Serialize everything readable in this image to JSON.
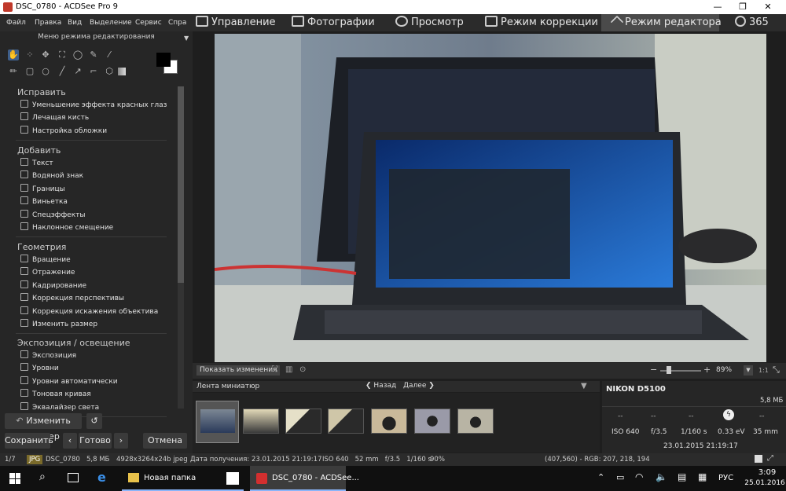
{
  "window": {
    "title": "DSC_0780 - ACDSee Pro 9",
    "min": "—",
    "max": "❐",
    "close": "✕"
  },
  "menu": [
    "Файл",
    "Правка",
    "Вид",
    "Выделение",
    "Сервис",
    "Спра"
  ],
  "modes": [
    {
      "label": "Управление",
      "icon": "grid-icon"
    },
    {
      "label": "Фотографии",
      "icon": "photos-icon"
    },
    {
      "label": "Просмотр",
      "icon": "eye-icon"
    },
    {
      "label": "Режим коррекции",
      "icon": "develop-icon"
    },
    {
      "label": "Режим редактора",
      "icon": "edit-tools-icon"
    },
    {
      "label": "365",
      "icon": "365-icon"
    }
  ],
  "panel": {
    "title": "Меню режима редактирования",
    "sections": [
      {
        "title": "Исправить",
        "items": [
          "Уменьшение эффекта красных глаз",
          "Лечащая кисть",
          "Настройка обложки"
        ]
      },
      {
        "title": "Добавить",
        "items": [
          "Текст",
          "Водяной знак",
          "Границы",
          "Виньетка",
          "Спецэффекты",
          "Наклонное смещение"
        ]
      },
      {
        "title": "Геометрия",
        "items": [
          "Вращение",
          "Отражение",
          "Кадрирование",
          "Коррекция перспективы",
          "Коррекция искажения объектива",
          "Изменить размер"
        ]
      },
      {
        "title": "Экспозиция / освещение",
        "items": [
          "Экспозиция",
          "Уровни",
          "Уровни автоматически",
          "Тоновая кривая",
          "Эквалайзер света"
        ]
      }
    ],
    "resize_btn": "Изменить размер",
    "save_btn": "Сохранить",
    "done_btn": "Готово",
    "cancel_btn": "Отмена"
  },
  "viewbar": {
    "show_changes": "Показать изменения",
    "zoom": "89%",
    "ratio": "1:1"
  },
  "film": {
    "title": "Лента миниатюр",
    "back": "Назад",
    "next": "Далее"
  },
  "exif": {
    "camera": "NIKON D5100",
    "size": "5,8 МБ",
    "row1": [
      "--",
      "--",
      "--",
      "ϟ",
      "--"
    ],
    "row2": [
      "ISO 640",
      "f/3.5",
      "1/160 s",
      "0.33 eV",
      "35 mm"
    ],
    "date": "23.01.2015 21:19:17"
  },
  "status": {
    "index": "1/7",
    "format": "JPG",
    "filename": "DSC_0780",
    "size": "5,8 МБ",
    "dims": "4928x3264x24b jpeg",
    "date": "Дата получения: 23.01.2015 21:19:17",
    "exposure": "ISO 640   52 mm   f/3.5   1/160 s",
    "zoom": "90%",
    "pixel": "(407,560) - RGB: 207, 218, 194"
  },
  "taskbar": {
    "folder": "Новая папка",
    "app": "DSC_0780 - ACDSee...",
    "lang": "РУС",
    "time": "3:09",
    "date": "25.01.2016"
  },
  "colors": {
    "accent": "#4a4a4a",
    "bg": "#262626"
  }
}
